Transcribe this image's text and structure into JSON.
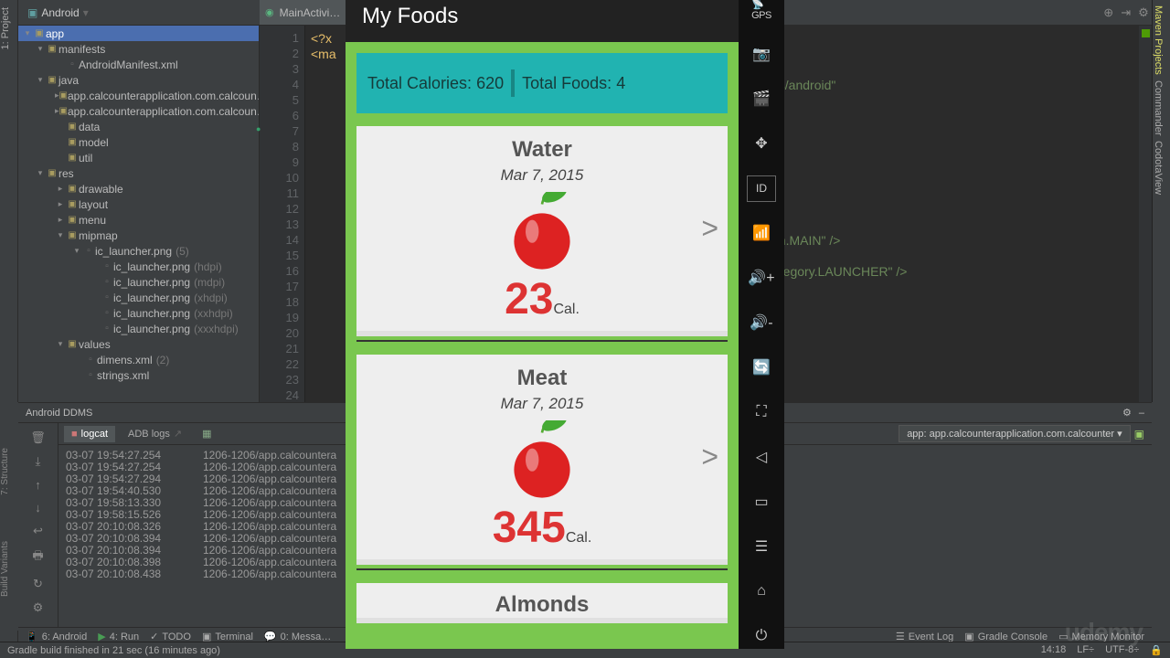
{
  "editor_tab": "MainActivi…",
  "crumb_project": "Android",
  "project_root": "app",
  "tree": {
    "manifests": "manifests",
    "manifest_file": "AndroidManifest.xml",
    "java": "java",
    "pkg1": "app.calcounterapplication.com.calcoun…",
    "pkg2": "app.calcounterapplication.com.calcoun…",
    "data": "data",
    "model": "model",
    "util": "util",
    "res": "res",
    "drawable": "drawable",
    "layout": "layout",
    "menu": "menu",
    "mipmap": "mipmap",
    "launcher": "ic_launcher.png",
    "launcher_count": "(5)",
    "var_hdpi": "(hdpi)",
    "var_mdpi": "(mdpi)",
    "var_xhdpi": "(xhdpi)",
    "var_xxhdpi": "(xxhdpi)",
    "var_xxxhdpi": "(xxxhdpi)",
    "values": "values",
    "dimens": "dimens.xml",
    "dimens_n": "(2)",
    "strings": "strings.xml"
  },
  "code": {
    "l1": "<?x",
    "l2": "<ma",
    "path": "es/android\"",
    "action": "on.MAIN\" />",
    "cat": "category.LAUNCHER\" />"
  },
  "ddms_title": "Android DDMS",
  "logcat_tab": "logcat",
  "adb_tab": "ADB logs",
  "device_drop": "app: app.calcounterapplication.com.calcounter",
  "log": [
    {
      "t": "03-07 19:54:27.254",
      "p": "1206-1206/app.calcountera"
    },
    {
      "t": "03-07 19:54:27.254",
      "p": "1206-1206/app.calcountera"
    },
    {
      "t": "03-07 19:54:27.294",
      "p": "1206-1206/app.calcountera"
    },
    {
      "t": "03-07 19:54:40.530",
      "p": "1206-1206/app.calcountera"
    },
    {
      "t": "03-07 19:58:13.330",
      "p": "1206-1206/app.calcountera"
    },
    {
      "t": "03-07 19:58:15.526",
      "p": "1206-1206/app.calcountera"
    },
    {
      "t": "03-07 20:10:08.326",
      "p": "1206-1206/app.calcountera"
    },
    {
      "t": "03-07 20:10:08.394",
      "p": "1206-1206/app.calcountera"
    },
    {
      "t": "03-07 20:10:08.394",
      "p": "1206-1206/app.calcountera"
    },
    {
      "t": "03-07 20:10:08.398",
      "p": "1206-1206/app.calcountera"
    },
    {
      "t": "03-07 20:10:08.438",
      "p": "1206-1206/app.calcountera"
    }
  ],
  "tools": {
    "android": "6: Android",
    "run": "4: Run",
    "todo": "TODO",
    "terminal": "Terminal",
    "messages": "0: Messa…",
    "eventlog": "Event Log",
    "gradle": "Gradle Console",
    "memory": "Memory Monitor"
  },
  "status": {
    "msg": "Gradle build finished in 21 sec (16 minutes ago)",
    "time": "14:18",
    "lf": "LF÷",
    "enc": "UTF-8÷"
  },
  "right_tabs": {
    "maven": "Maven Projects",
    "commander": "Commander",
    "codota": "CodotaView"
  },
  "phone": {
    "title": "My Foods",
    "total_cal_label": "Total Calories:",
    "total_cal": "620",
    "total_food_label": "Total Foods:",
    "total_foods": "4",
    "cards": [
      {
        "name": "Water",
        "date": "Mar 7, 2015",
        "cal": "23",
        "unit": "Cal."
      },
      {
        "name": "Meat",
        "date": "Mar 7, 2015",
        "cal": "345",
        "unit": "Cal."
      },
      {
        "name": "Almonds",
        "date": "",
        "cal": "",
        "unit": ""
      }
    ]
  },
  "emu": {
    "gps": "GPS",
    "id": "ID"
  },
  "watermark": "udemy"
}
